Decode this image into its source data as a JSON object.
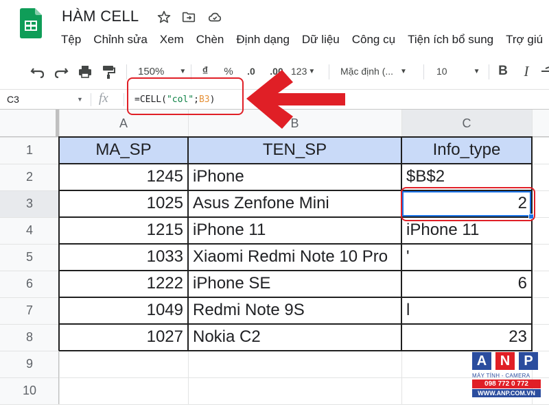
{
  "window": {
    "title": "HÀM CELL",
    "title_icons": [
      "star-icon",
      "move-to-folder-icon",
      "cloud-status-icon"
    ]
  },
  "menu": {
    "items": [
      "Tệp",
      "Chỉnh sửa",
      "Xem",
      "Chèn",
      "Định dạng",
      "Dữ liệu",
      "Công cụ",
      "Tiện ích bổ sung",
      "Trợ giú"
    ]
  },
  "toolbar": {
    "zoom": "150%",
    "currency": "₫",
    "percent": "%",
    "decrease_decimal": ".0",
    "increase_decimal": ".00",
    "more_formats": "123",
    "font_family": "Mặc định (...",
    "font_size": "10",
    "bold": "B",
    "italic": "I"
  },
  "formula_bar": {
    "name_box": "C3",
    "fx_label": "fx",
    "formula_prefix": "=CELL(",
    "formula_string": "\"col\"",
    "formula_sep": ";",
    "formula_ref": "B3",
    "formula_suffix": ")"
  },
  "sheet": {
    "columns": [
      "A",
      "B",
      "C"
    ],
    "rows": [
      [
        "MA_SP",
        "TEN_SP",
        "Info_type"
      ],
      [
        "1245",
        "iPhone",
        "$B$2"
      ],
      [
        "1025",
        "Asus Zenfone Mini",
        "2"
      ],
      [
        "1215",
        "iPhone 11",
        "iPhone 11"
      ],
      [
        "1033",
        "Xiaomi Redmi Note 10 Pro",
        "'"
      ],
      [
        "1222",
        "iPhone SE",
        "6"
      ],
      [
        "1049",
        "Redmi Note 9S",
        "l"
      ],
      [
        "1027",
        "Nokia C2",
        "23"
      ],
      [
        "",
        "",
        ""
      ],
      [
        "",
        "",
        ""
      ]
    ],
    "row_numbers": [
      "1",
      "2",
      "3",
      "4",
      "5",
      "6",
      "7",
      "8",
      "9",
      "10"
    ],
    "selected_cell": "C3",
    "header_fill": "#c9daf8"
  },
  "watermark": {
    "letters": [
      "A",
      "N",
      "P"
    ],
    "line1": "MÁY TÍNH - CAMERA",
    "phone": "098 772 0 772",
    "website": "WWW.ANP.COM.VN"
  },
  "colors": {
    "annotation_red": "#e01f26",
    "selection_blue": "#1a73e8",
    "sheets_green": "#0f9d58",
    "watermark_blue": "#2b4d9e"
  }
}
